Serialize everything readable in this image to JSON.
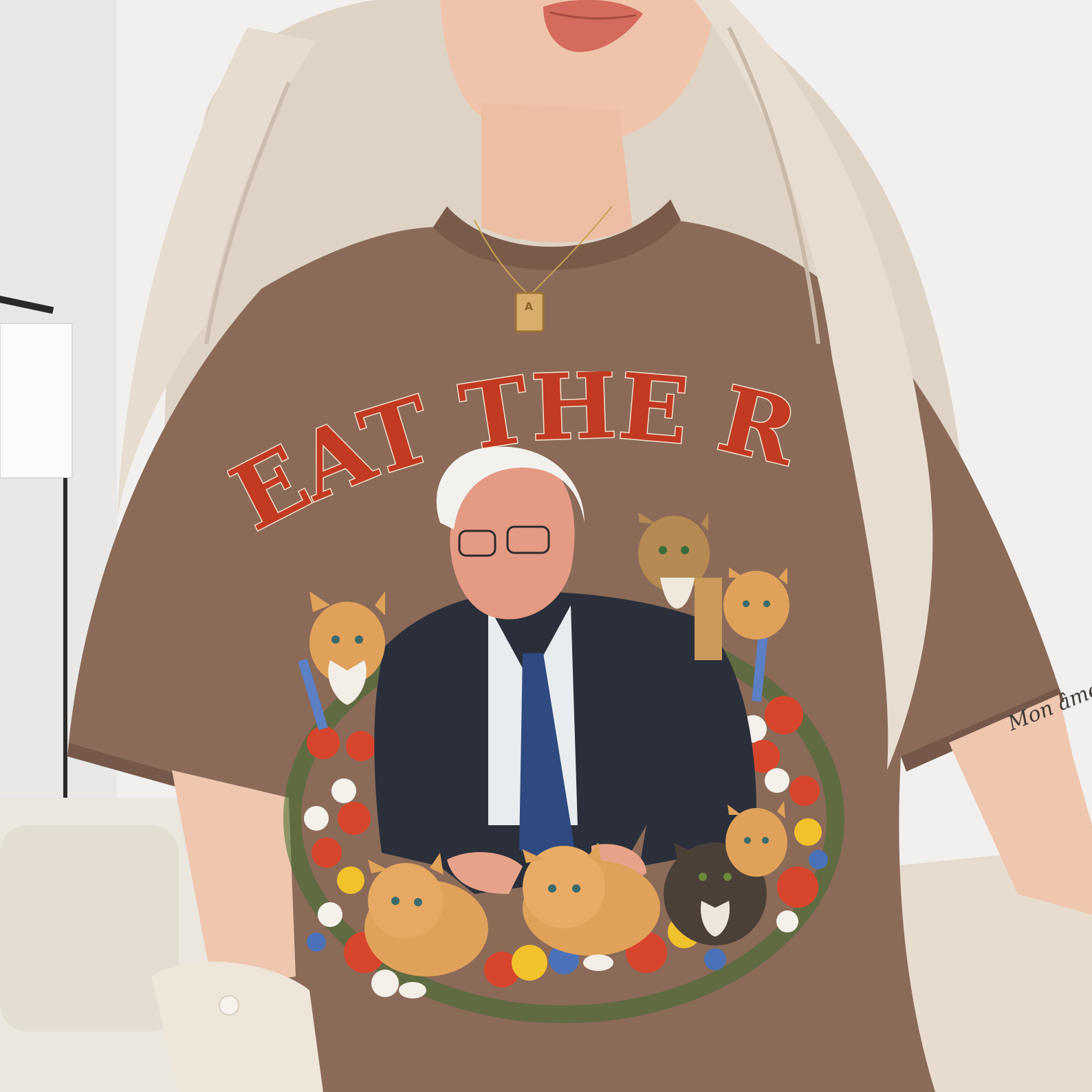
{
  "shirt_graphic": {
    "headline": "EAT THE RICH",
    "headline_color": "#c23a22",
    "shirt_color": "#8b6a58",
    "subjects": [
      "portrait-of-man-in-suit",
      "kittens",
      "wildflowers"
    ]
  },
  "pendant": {
    "letter": "A"
  },
  "tattoo": {
    "text": "Mon âme"
  },
  "colors": {
    "wall": "#f1f0ee",
    "hair": "#e2d7cb",
    "skin": "#efc6ae",
    "jacket": "#2a2f3a",
    "kitten_orange": "#e0a15a",
    "flower_red": "#d8452d",
    "flower_blue": "#4b72b8"
  }
}
